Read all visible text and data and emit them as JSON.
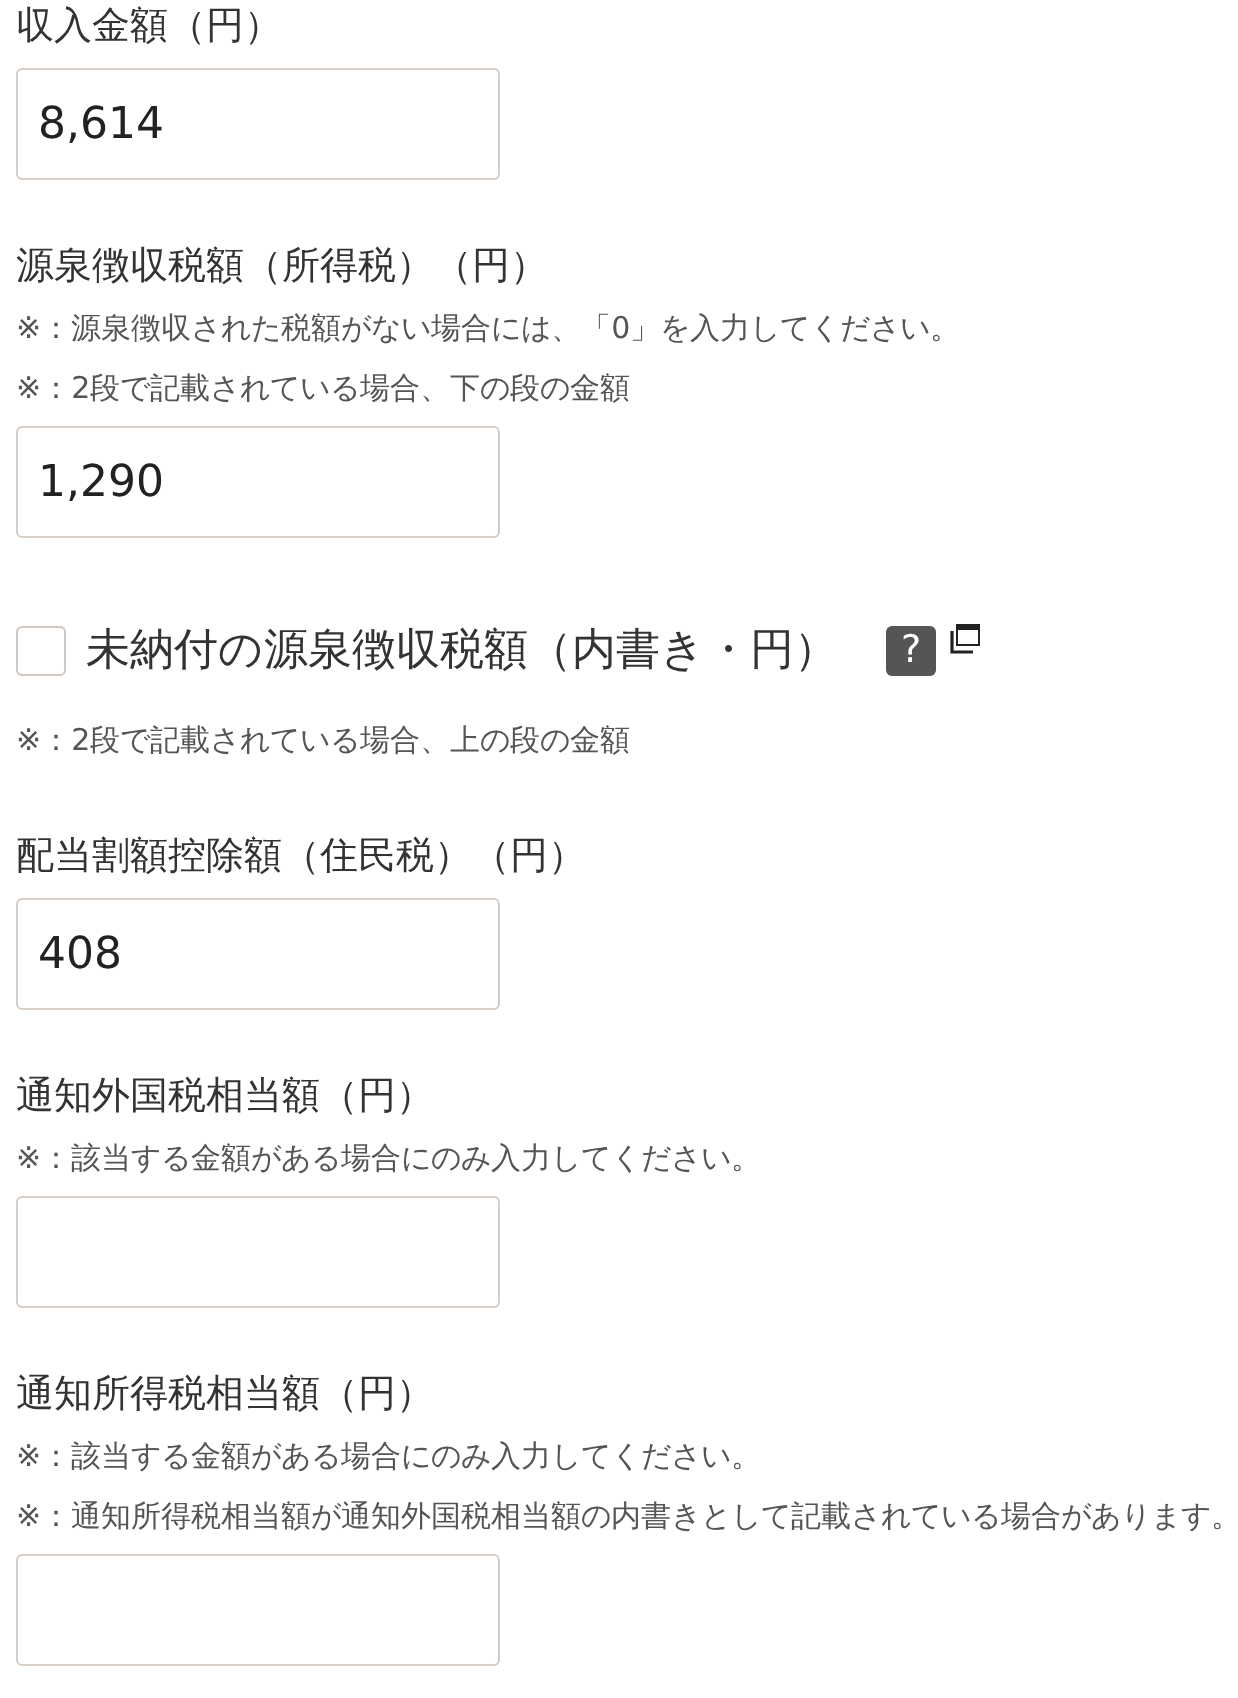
{
  "fields": [
    {
      "kind": "input",
      "label": "収入金額（円）",
      "value": "8,614"
    },
    {
      "kind": "input",
      "label": "源泉徴収税額（所得税）（円）",
      "notes": [
        "※：源泉徴収された税額がない場合には、「0」を入力してください。",
        "※：2段で記載されている場合、下の段の金額"
      ],
      "value": "1,290"
    },
    {
      "kind": "checkbox",
      "label": "未納付の源泉徴収税額（内書き・円）",
      "checked": false,
      "help": "?",
      "notes": [
        "※：2段で記載されている場合、上の段の金額"
      ]
    },
    {
      "kind": "input",
      "label": "配当割額控除額（住民税）（円）",
      "value": "408"
    },
    {
      "kind": "input",
      "label": "通知外国税相当額（円）",
      "notes": [
        "※：該当する金額がある場合にのみ入力してください。"
      ]
    },
    {
      "kind": "input",
      "label": "通知所得税相当額（円）",
      "notes": [
        "※：該当する金額がある場合にのみ入力してください。",
        "※：通知所得税相当額が通知外国税相当額の内書きとして記載されている場合があります。"
      ]
    }
  ]
}
